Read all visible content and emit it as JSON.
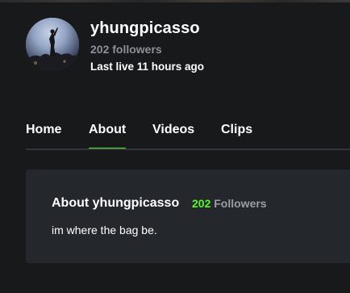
{
  "channel": {
    "name": "yhungpicasso",
    "followers": "202 followers",
    "last_live": "Last live 11 hours ago"
  },
  "tabs": [
    {
      "label": "Home",
      "active": false
    },
    {
      "label": "About",
      "active": true
    },
    {
      "label": "Videos",
      "active": false
    },
    {
      "label": "Clips",
      "active": false
    }
  ],
  "about": {
    "title": "About yhungpicasso",
    "follower_count": "202",
    "follower_label": "Followers",
    "bio": "im where the bag be."
  },
  "colors": {
    "accent": "#53fc18",
    "background": "#18191b",
    "card": "#24272b",
    "muted_text": "#8b8f98"
  },
  "icons": {
    "avatar": "avatar-image"
  }
}
